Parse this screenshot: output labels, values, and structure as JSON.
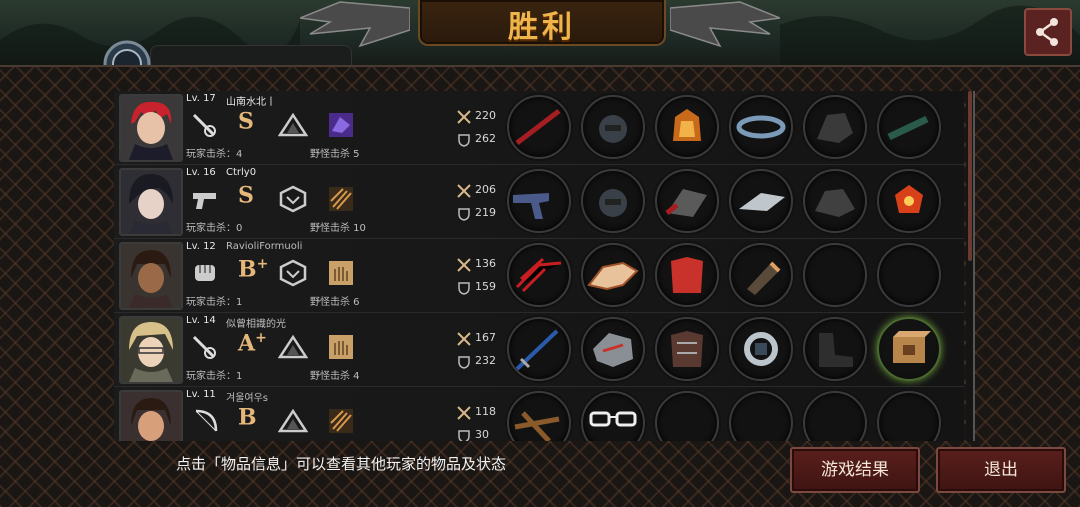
{
  "header": {
    "title": "胜利",
    "team_label": ""
  },
  "players": [
    {
      "level": "Lv. 17",
      "name": "山南水北丨",
      "grade": "S",
      "grade_plus": "",
      "player_kills": "玩家击杀：4",
      "monster_kills": "野怪击杀 5",
      "attack": "220",
      "defense": "262",
      "weapon_icon": "rapier-icon",
      "filled_slots": 6
    },
    {
      "level": "Lv. 16",
      "name": "Ctrly0",
      "grade": "S",
      "grade_plus": "",
      "player_kills": "玩家击杀：0",
      "monster_kills": "野怪击杀 10",
      "attack": "206",
      "defense": "219",
      "weapon_icon": "pistol-icon",
      "filled_slots": 6
    },
    {
      "level": "Lv. 12",
      "name": "RavioliFormuoli",
      "grade": "B",
      "grade_plus": "+",
      "player_kills": "玩家击杀：1",
      "monster_kills": "野怪击杀 6",
      "attack": "136",
      "defense": "159",
      "weapon_icon": "fist-icon",
      "filled_slots": 4
    },
    {
      "level": "Lv. 14",
      "name": "似曾相識的光",
      "grade": "A",
      "grade_plus": "+",
      "player_kills": "玩家击杀：1",
      "monster_kills": "野怪击杀 4",
      "attack": "167",
      "defense": "232",
      "weapon_icon": "rapier-icon",
      "filled_slots": 6
    },
    {
      "level": "Lv. 11",
      "name": "겨울여우s",
      "grade": "B",
      "grade_plus": "",
      "player_kills": "",
      "monster_kills": "",
      "attack": "118",
      "defense": "30",
      "weapon_icon": "bow-icon",
      "filled_slots": 2
    }
  ],
  "footer": {
    "hint": "点击「物品信息」可以查看其他玩家的物品及状态",
    "result_button": "游戏结果",
    "exit_button": "退出"
  },
  "colors": {
    "accent_gold": "#f0b54a",
    "button_red": "#5a1f1c",
    "grade_color": "#e5b77a"
  }
}
